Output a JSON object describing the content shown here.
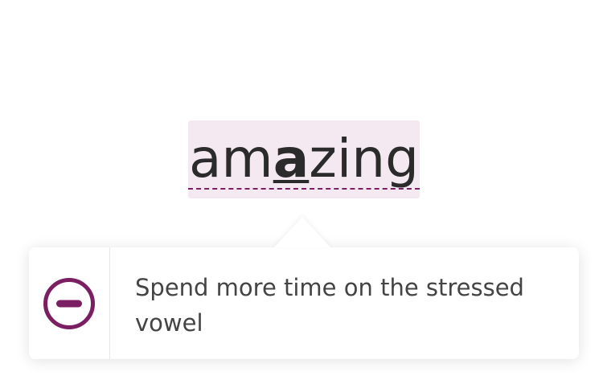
{
  "word": {
    "before": "am",
    "stressed": "a",
    "after": "zing"
  },
  "feedback": {
    "icon": "minus-circle-icon",
    "message": "Spend more time on the stressed vowel"
  },
  "colors": {
    "accent": "#7c1f62",
    "highlight": "#f4e8f1",
    "text": "#2b2b2b",
    "message_text": "#444444"
  }
}
